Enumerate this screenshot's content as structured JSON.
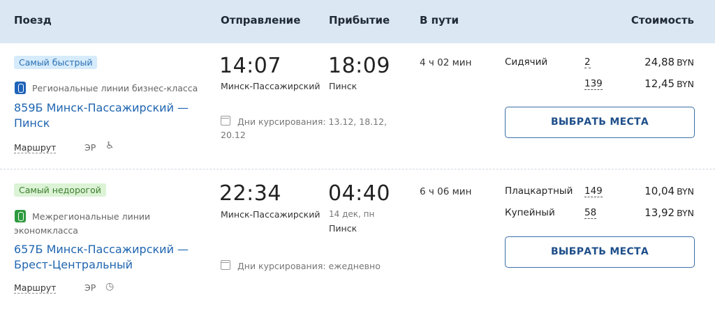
{
  "header": {
    "train": "Поезд",
    "departure": "Отправление",
    "arrival": "Прибытие",
    "travel_time": "В пути",
    "price": "Стоимость"
  },
  "trains": [
    {
      "badge": "Самый быстрый",
      "carrier": "Региональные линии бизнес-класса",
      "name_line1": "859Б Минск-Пассажирский —",
      "name_line2": "Пинск",
      "route_label": "Маршрут",
      "type": "ЭР",
      "extra_icon": "wheelchair-icon",
      "dep_time": "14:07",
      "dep_station": "Минск-Пассажирский",
      "arr_time": "18:09",
      "arr_date": "",
      "arr_station": "Пинск",
      "days_line1": "Дни курсирования: 13.12, 18.12,",
      "days_line2": "20.12",
      "duration": "4 ч 02 мин",
      "seats": [
        {
          "type": "Сидячий",
          "count": "2",
          "price": "24,88",
          "currency": "BYN"
        },
        {
          "type": "",
          "count": "139",
          "price": "12,45",
          "currency": "BYN"
        }
      ],
      "button": "ВЫБРАТЬ МЕСТА"
    },
    {
      "badge": "Самый недорогой",
      "carrier_line1": "Межрегиональные линии",
      "carrier_line2": "экономкласса",
      "name_line1": "657Б Минск-Пассажирский —",
      "name_line2": "Брест-Центральный",
      "route_label": "Маршрут",
      "type": "ЭР",
      "extra_icon": "clock-icon",
      "dep_time": "22:34",
      "dep_station": "Минск-Пассажирский",
      "arr_time": "04:40",
      "arr_date": "14 дек, пн",
      "arr_station": "Пинск",
      "days_line1": "Дни курсирования: ежедневно",
      "duration": "6 ч 06 мин",
      "seats": [
        {
          "type": "Плацкартный",
          "count": "149",
          "price": "10,04",
          "currency": "BYN"
        },
        {
          "type": "Купейный",
          "count": "58",
          "price": "13,92",
          "currency": "BYN"
        }
      ],
      "button": "ВЫБРАТЬ МЕСТА"
    }
  ],
  "colors": {
    "header_bg": "#dbe7f3",
    "link": "#1f65b0",
    "badge_fast": "#d6ebfb",
    "badge_cheap": "#dcf3d6"
  }
}
